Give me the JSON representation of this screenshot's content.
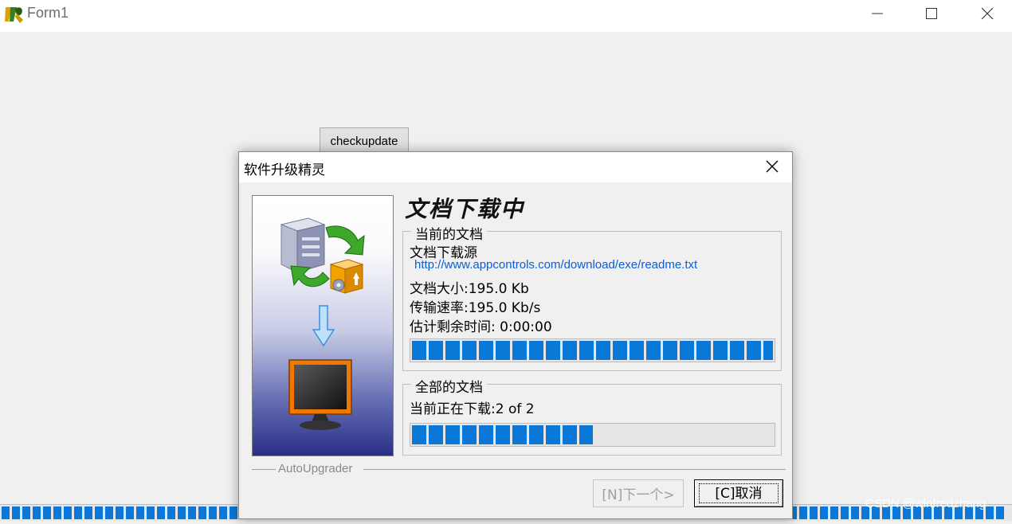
{
  "form": {
    "title": "Form1",
    "checkupdate_label": "checkupdate",
    "progress_percent": 100
  },
  "dialog": {
    "title": "软件升级精灵",
    "header_title": "文档下载中",
    "current_group": {
      "legend": "当前的文档",
      "source_label": "文档下载源",
      "source_url": "http://www.appcontrols.com/download/exe/readme.txt",
      "size_text": "文档大小:195.0 Kb",
      "speed_text": "传输速率:195.0 Kb/s",
      "remaining_text": "估计剩余时间: 0:00:00",
      "progress_percent": 100
    },
    "all_group": {
      "legend": "全部的文档",
      "status_text": "当前正在下载:2 of 2",
      "progress_percent": 50
    },
    "footer_label": "AutoUpgrader",
    "next_button": "[N]下一个>",
    "cancel_button": "[C]取消"
  },
  "watermark": "CSDN @wlnfredzhang",
  "colors": {
    "progress_segment": "#0a78d7",
    "link": "#0b5ed7"
  }
}
